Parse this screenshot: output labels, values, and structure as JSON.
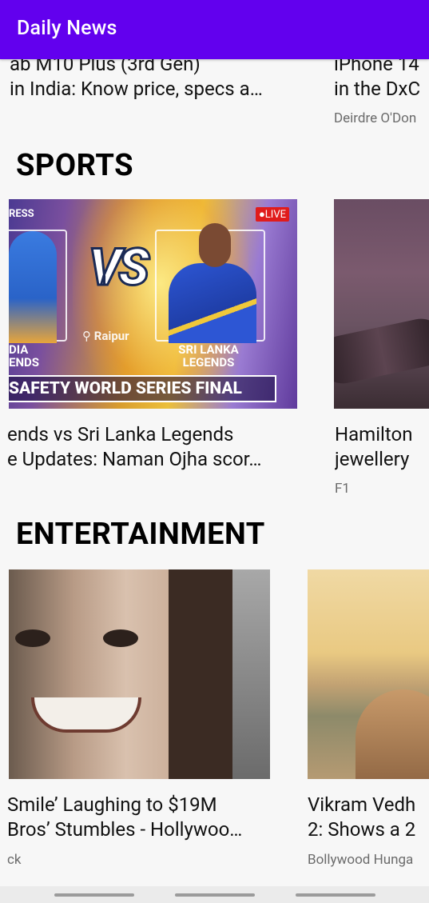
{
  "app": {
    "title": "Daily News"
  },
  "top_cards": [
    {
      "title_line1": "ab M10 Plus (3rd Gen)",
      "title_line2": "in India: Know price, specs a…",
      "source": ""
    },
    {
      "title_line1": "iPhone 14",
      "title_line2": "in the DxC",
      "source": "Deirdre O'Don"
    }
  ],
  "sports": {
    "heading": "SPORTS",
    "image_text": {
      "live": "●LIVE",
      "ress": "RESS",
      "vs": "VS",
      "place": "⚲ Raipur",
      "team_left_1": "DIA",
      "team_left_2": "ENDS",
      "team_right_1": "SRI LANKA",
      "team_right_2": "LEGENDS",
      "banner": "SAFETY WORLD SERIES FINAL"
    },
    "cards": [
      {
        "title_line1": "ends vs Sri Lanka Legends",
        "title_line2": "e Updates: Naman Ojha scor…",
        "source": ""
      },
      {
        "title_line1": "Hamilton",
        "title_line2": "jewellery",
        "source": "F1"
      }
    ]
  },
  "entertainment": {
    "heading": "ENTERTAINMENT",
    "cards": [
      {
        "title_line1": "Smile’ Laughing to $19M",
        "title_line2": "Bros’ Stumbles - Hollywoo…",
        "source": "ck"
      },
      {
        "title_line1": "Vikram Vedh",
        "title_line2": "2: Shows a 2",
        "source": "Bollywood Hunga"
      }
    ]
  }
}
